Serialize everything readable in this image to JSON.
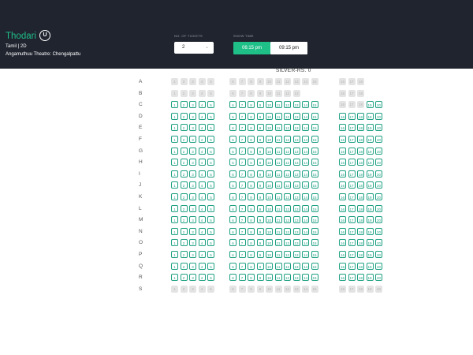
{
  "movie": {
    "title": "Thodari",
    "certificate": "U",
    "meta": "Tamil | 2D",
    "venue": "Angamuthuu Theatre: Chengalpattu"
  },
  "tickets": {
    "label": "NO. OF TICKETS",
    "value": "2"
  },
  "showtime": {
    "label": "SHOW TIME",
    "times": [
      "06:15 pm",
      "09:15 pm"
    ],
    "selected": "06:15 pm"
  },
  "seating": {
    "section_title": "SILVER-RS. 0",
    "rows": [
      {
        "label": "A",
        "sold": [
          1,
          2,
          3,
          4,
          5,
          6,
          7,
          8,
          9,
          10,
          11,
          12,
          13,
          14,
          15,
          16,
          17,
          18
        ],
        "available": []
      },
      {
        "label": "B",
        "sold": [
          1,
          2,
          3,
          4,
          5,
          6,
          7,
          8,
          9,
          10,
          11,
          12,
          13,
          16,
          17,
          18
        ],
        "available": []
      },
      {
        "label": "C",
        "sold": [
          16,
          17,
          18
        ],
        "available": [
          1,
          2,
          3,
          4,
          5,
          6,
          7,
          8,
          9,
          10,
          11,
          12,
          13,
          14,
          15,
          19,
          20
        ]
      },
      {
        "label": "D",
        "sold": [],
        "available": [
          1,
          2,
          3,
          4,
          5,
          6,
          7,
          8,
          9,
          10,
          11,
          12,
          13,
          14,
          15,
          16,
          17,
          18,
          19,
          20
        ]
      },
      {
        "label": "E",
        "sold": [],
        "available": [
          1,
          2,
          3,
          4,
          5,
          6,
          7,
          8,
          9,
          10,
          11,
          12,
          13,
          14,
          15,
          16,
          17,
          18,
          19,
          20
        ]
      },
      {
        "label": "F",
        "sold": [],
        "available": [
          1,
          2,
          3,
          4,
          5,
          6,
          7,
          8,
          9,
          10,
          11,
          12,
          13,
          14,
          15,
          16,
          17,
          18,
          19,
          20
        ]
      },
      {
        "label": "G",
        "sold": [],
        "available": [
          1,
          2,
          3,
          4,
          5,
          6,
          7,
          8,
          9,
          10,
          11,
          12,
          13,
          14,
          15,
          16,
          17,
          18,
          19,
          20
        ]
      },
      {
        "label": "H",
        "sold": [],
        "available": [
          1,
          2,
          3,
          4,
          5,
          6,
          7,
          8,
          9,
          10,
          11,
          12,
          13,
          14,
          15,
          16,
          17,
          18,
          19,
          20
        ]
      },
      {
        "label": "I",
        "sold": [],
        "available": [
          1,
          2,
          3,
          4,
          5,
          6,
          7,
          8,
          9,
          10,
          11,
          12,
          13,
          14,
          15,
          16,
          17,
          18,
          19,
          20
        ]
      },
      {
        "label": "J",
        "sold": [],
        "available": [
          1,
          2,
          3,
          4,
          5,
          6,
          7,
          8,
          9,
          10,
          11,
          12,
          13,
          14,
          15,
          16,
          17,
          18,
          19,
          20
        ]
      },
      {
        "label": "K",
        "sold": [],
        "available": [
          1,
          2,
          3,
          4,
          5,
          6,
          7,
          8,
          9,
          10,
          11,
          12,
          13,
          14,
          15,
          16,
          17,
          18,
          19,
          20
        ]
      },
      {
        "label": "L",
        "sold": [],
        "available": [
          1,
          2,
          3,
          4,
          5,
          6,
          7,
          8,
          9,
          10,
          11,
          12,
          13,
          14,
          15,
          16,
          17,
          18,
          19,
          20
        ]
      },
      {
        "label": "M",
        "sold": [],
        "available": [
          1,
          2,
          3,
          4,
          5,
          6,
          7,
          8,
          9,
          10,
          11,
          12,
          13,
          14,
          15,
          16,
          17,
          18,
          19,
          20
        ]
      },
      {
        "label": "N",
        "sold": [],
        "available": [
          1,
          2,
          3,
          4,
          5,
          6,
          7,
          8,
          9,
          10,
          11,
          12,
          13,
          14,
          15,
          16,
          17,
          18,
          19,
          20
        ]
      },
      {
        "label": "O",
        "sold": [],
        "available": [
          1,
          2,
          3,
          4,
          5,
          6,
          7,
          8,
          9,
          10,
          11,
          12,
          13,
          14,
          15,
          16,
          17,
          18,
          19,
          20
        ]
      },
      {
        "label": "P",
        "sold": [],
        "available": [
          1,
          2,
          3,
          4,
          5,
          6,
          7,
          8,
          9,
          10,
          11,
          12,
          13,
          14,
          15,
          16,
          17,
          18,
          19,
          20
        ]
      },
      {
        "label": "Q",
        "sold": [],
        "available": [
          1,
          2,
          3,
          4,
          5,
          6,
          7,
          8,
          9,
          10,
          11,
          12,
          13,
          14,
          15,
          16,
          17,
          18,
          19,
          20
        ]
      },
      {
        "label": "R",
        "sold": [],
        "available": [
          1,
          2,
          3,
          4,
          5,
          6,
          7,
          8,
          9,
          10,
          11,
          12,
          13,
          14,
          15,
          16,
          17,
          18,
          19,
          20
        ]
      },
      {
        "label": "S",
        "sold": [
          1,
          2,
          3,
          4,
          5,
          6,
          7,
          8,
          9,
          10,
          11,
          12,
          13,
          14,
          15,
          16,
          17,
          18,
          19,
          20
        ],
        "available": []
      }
    ]
  },
  "colors": {
    "header_bg": "#20242f",
    "accent": "#1fbf88",
    "seat_available": "#1ea083",
    "seat_sold": "#e4e4e4"
  }
}
